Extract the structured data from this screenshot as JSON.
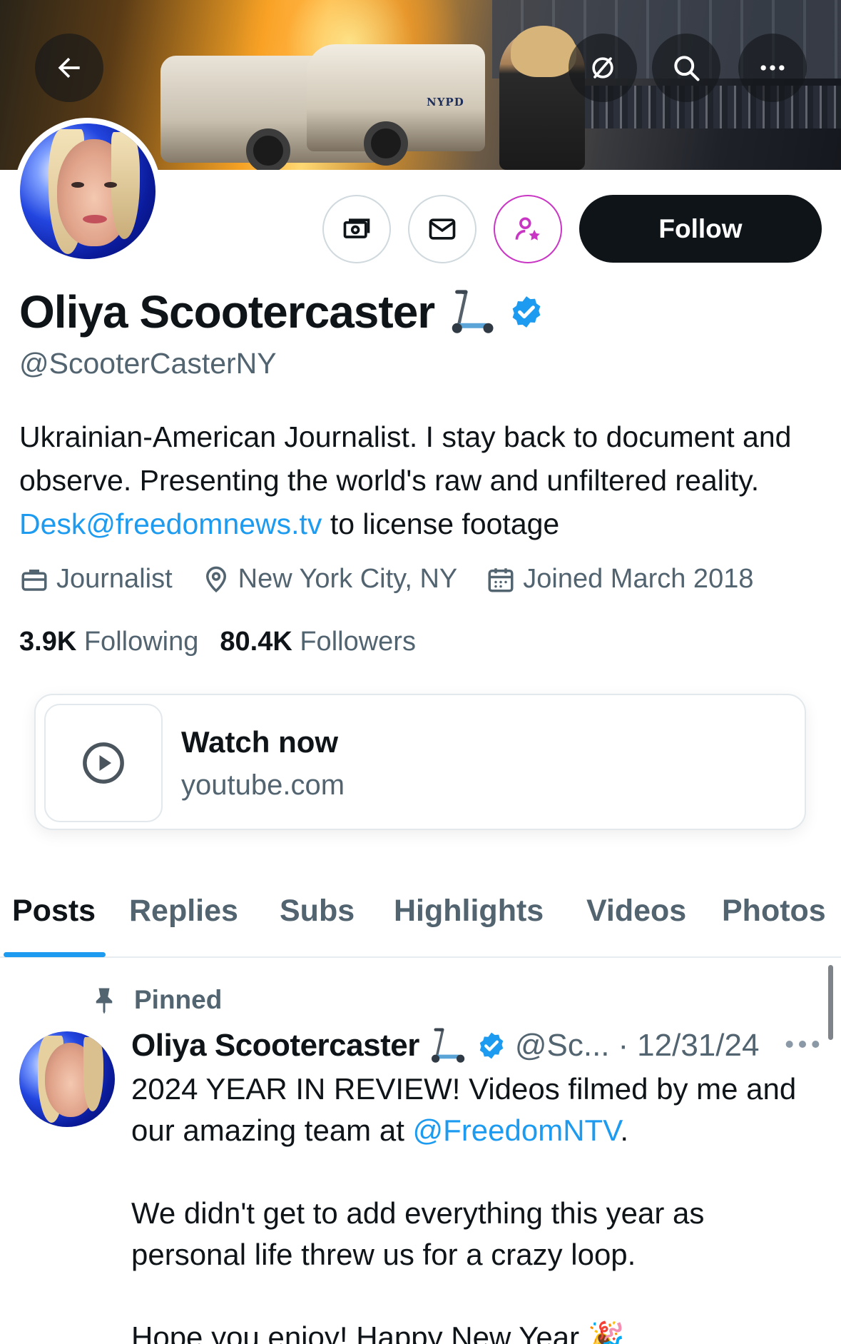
{
  "banner": {
    "image_description": "",
    "vehicle_tag": "NYPD",
    "buttons": [
      {
        "name": "back",
        "icon": "arrow-left-icon"
      },
      {
        "name": "grok",
        "icon": "slashed-circle-icon"
      },
      {
        "name": "search",
        "icon": "search-icon"
      },
      {
        "name": "more",
        "icon": "more-horizontal-icon"
      }
    ]
  },
  "profile": {
    "name": "Oliya Scootercaster",
    "name_emoji": "kick-scooter-icon",
    "verified": true,
    "handle": "@ScooterCasterNY",
    "bio_text_1": "Ukrainian-American Journalist. I stay back to document and observe. Presenting the world's raw and unfiltered reality. ",
    "bio_link": "Desk@freedomnews.tv",
    "bio_text_2": " to license footage",
    "profession": "Journalist",
    "location": "New York City, NY",
    "joined": "Joined March 2018",
    "following_count": "3.9K",
    "following_label": "Following",
    "followers_count": "80.4K",
    "followers_label": "Followers"
  },
  "actions": {
    "tip_icon": "money-icon",
    "message_icon": "mail-icon",
    "subscribe_icon": "person-star-icon",
    "follow_label": "Follow"
  },
  "link_card": {
    "title": "Watch now",
    "url": "youtube.com",
    "icon": "play-circle-icon"
  },
  "tabs": [
    "Posts",
    "Replies",
    "Subs",
    "Highlights",
    "Videos",
    "Photos"
  ],
  "active_tab": "Posts",
  "post": {
    "pinned_label": "Pinned",
    "author_name": "Oliya Scootercaster",
    "author_handle": "@Sc...",
    "date": "12/31/24",
    "line1_a": "2024 YEAR IN REVIEW! Videos filmed by me and our amazing team at ",
    "line1_mention": "@FreedomNTV",
    "line1_b": ".",
    "paragraph2": "We didn't get to add everything this year as personal life threw us for a crazy loop.",
    "paragraph3": " Hope you enjoy! Happy New Year 🎉"
  },
  "colors": {
    "accent": "#1d9bf0",
    "text_primary": "#0f1419",
    "text_secondary": "#536471",
    "subscribe_accent": "#c936c4"
  }
}
